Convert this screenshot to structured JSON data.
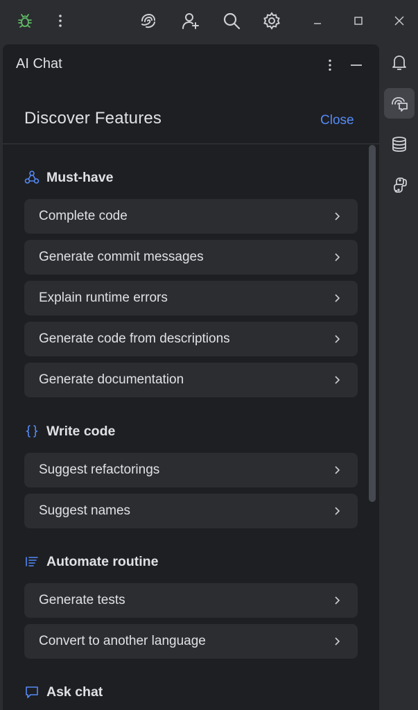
{
  "titlebar": {
    "icons": [
      "bug-icon",
      "more-vertical-icon",
      "ai-assistant-icon",
      "add-user-icon",
      "search-icon",
      "gear-icon",
      "minimize-icon",
      "maximize-icon",
      "close-icon"
    ]
  },
  "panel": {
    "title": "AI Chat",
    "header_icons": [
      "more-vertical-icon",
      "minimize-icon"
    ]
  },
  "discover": {
    "title": "Discover Features",
    "close_label": "Close"
  },
  "sections": [
    {
      "title": "Must-have",
      "icon": "triangle-nodes-icon",
      "items": [
        "Complete code",
        "Generate commit messages",
        "Explain runtime errors",
        "Generate code from descriptions",
        "Generate documentation"
      ]
    },
    {
      "title": "Write code",
      "icon": "braces-icon",
      "items": [
        "Suggest refactorings",
        "Suggest names"
      ]
    },
    {
      "title": "Automate routine",
      "icon": "list-icon",
      "items": [
        "Generate tests",
        "Convert to another language"
      ]
    },
    {
      "title": "Ask chat",
      "icon": "chat-bubble-icon",
      "items": []
    }
  ],
  "tool_strip": [
    "bell-icon",
    "ai-chat-icon",
    "database-icon",
    "python-icon"
  ],
  "colors": {
    "background": "#2b2d30",
    "panel": "#1e1f22",
    "item": "#2b2d30",
    "accent": "#548af7",
    "bug_green": "#5fb865",
    "text": "#dfe1e5"
  }
}
